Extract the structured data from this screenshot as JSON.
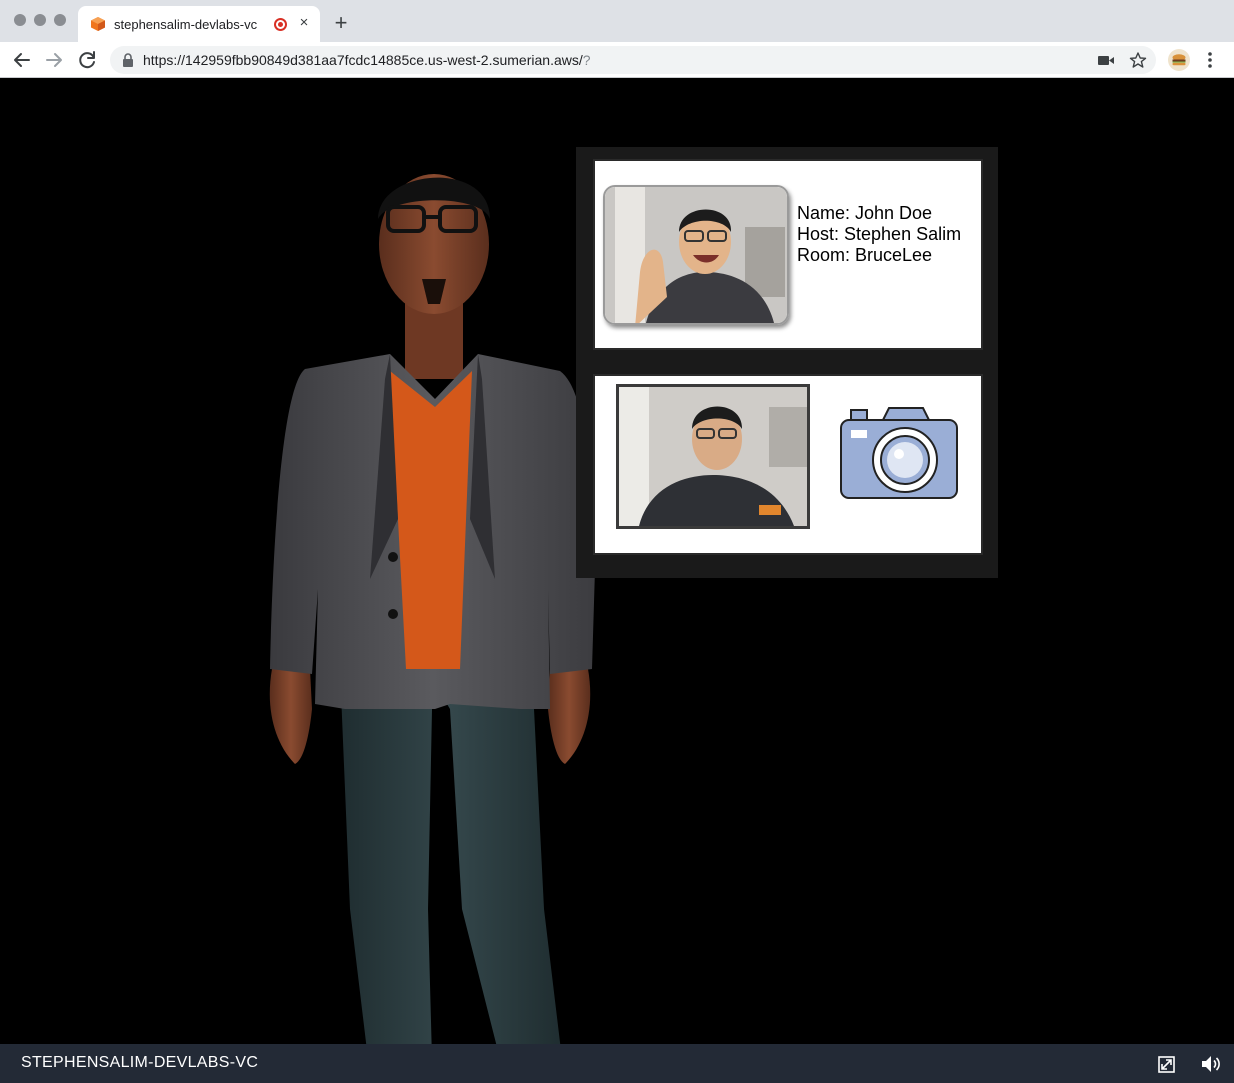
{
  "browser": {
    "tab": {
      "title": "stephensalim-devlabs-vc",
      "favicon": "sumerian-cube-icon",
      "recording_indicator": "record-icon",
      "close_glyph": "×"
    },
    "new_tab_glyph": "+",
    "url": {
      "main": "https://142959fbb90849d381aa7fcdc14885ce.us-west-2.sumerian.aws/",
      "suffix": "?"
    },
    "icons": [
      "back-arrow-icon",
      "forward-arrow-icon",
      "reload-icon",
      "lock-icon",
      "camera-permission-icon",
      "star-bookmark-icon",
      "profile-avatar",
      "menu-dots-icon"
    ]
  },
  "scene": {
    "host_name": "host-avatar",
    "badge": {
      "name_line": "Name: John Doe",
      "host_line": "Host: Stephen Salim",
      "room_line": "Room: BruceLee"
    },
    "capture": {
      "button_icon": "camera-icon",
      "button_color": "#9aaed6"
    }
  },
  "footer": {
    "title": "STEPHENSALIM-DEVLABS-VC",
    "icons": [
      "fullscreen-icon",
      "volume-icon"
    ]
  },
  "colors": {
    "tabstrip": "#dee1e6",
    "scene_bg": "#000000",
    "footer_bg": "#232a36",
    "favicon_orange": "#f0761d"
  }
}
